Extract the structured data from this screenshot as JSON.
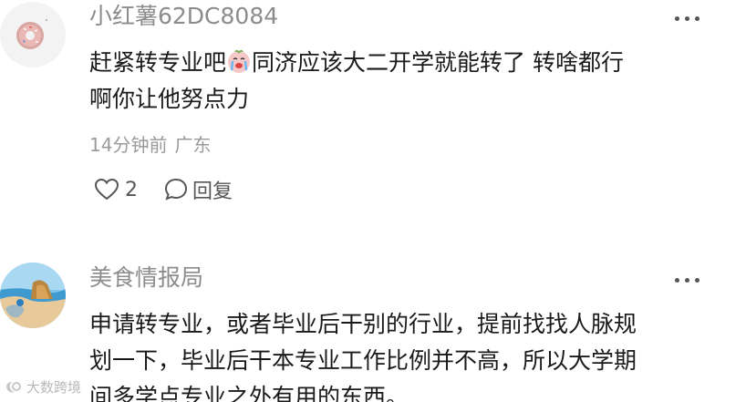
{
  "comments": [
    {
      "username": "小红薯62DC8084",
      "avatar_icon": "donut-icon",
      "content_line1_before": "赶紧转专业吧",
      "content_emoji": "crying-face-emoji",
      "content_line1_after": "同济应该大二开学就能转了 转啥都行",
      "content_line2": "啊你让他努点力",
      "time": "14分钟前",
      "location": "广东",
      "likes": "2",
      "reply_label": "回复"
    },
    {
      "username": "美食情报局",
      "avatar_icon": "beach-photo-avatar",
      "content_line1": "申请转专业，或者毕业后干别的行业，提前找找人脉规",
      "content_line2": "划一下，毕业后干本专业工作比例并不高，所以大学期",
      "content_line3": "间多学点专业之外有用的东西。"
    }
  ],
  "watermark": {
    "icon": "logo-mark-icon",
    "text": "大数跨境"
  },
  "colors": {
    "username": "#8c8c8c",
    "content": "#1a1a1a",
    "meta": "#9a9a9a",
    "icon": "#555555"
  }
}
